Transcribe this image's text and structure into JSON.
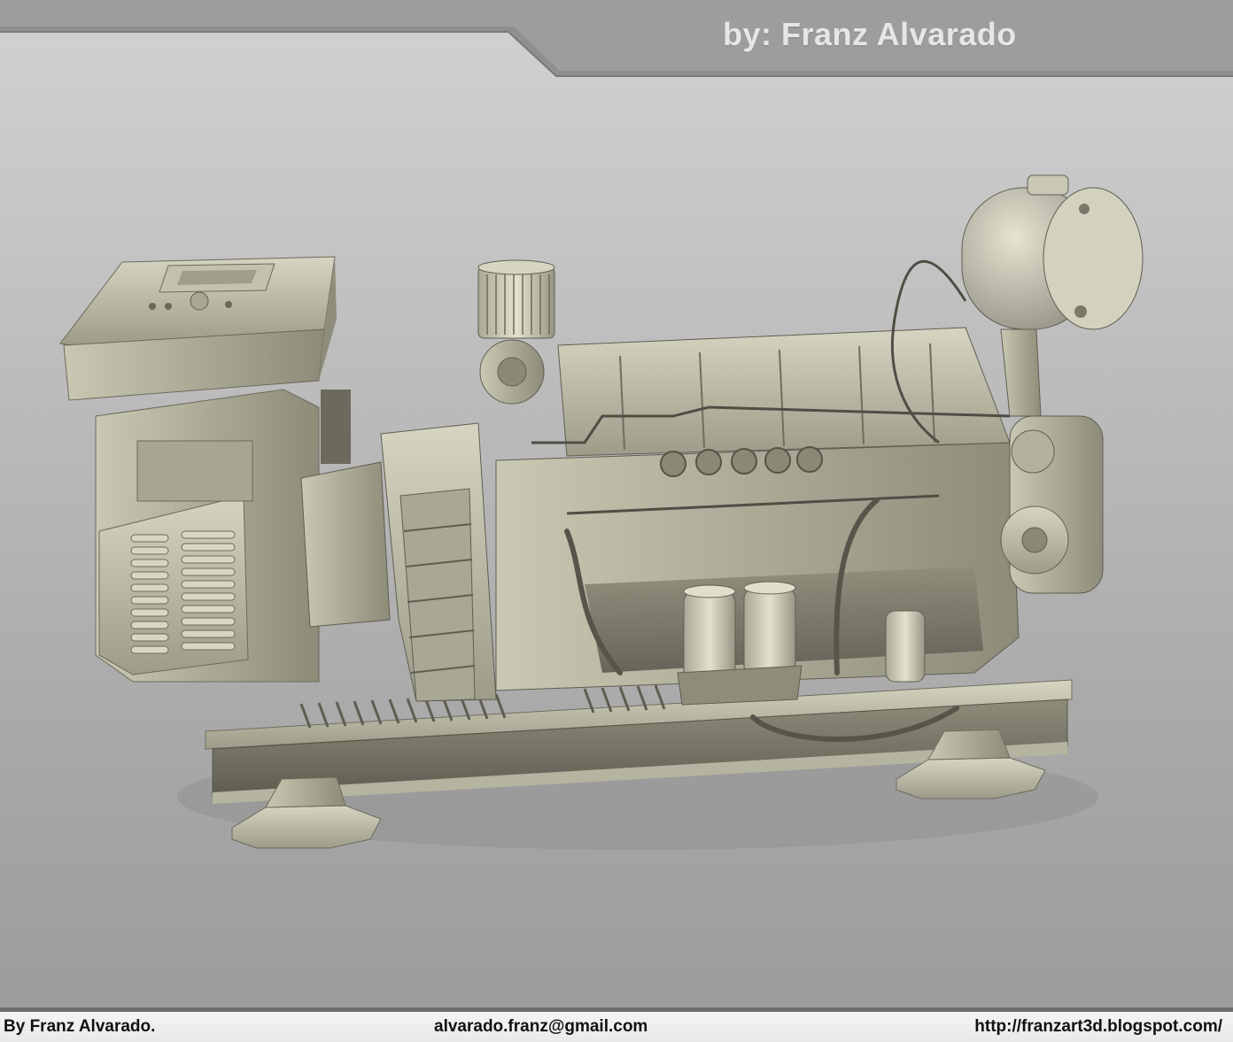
{
  "header": {
    "title": "by: Franz Alvarado"
  },
  "footer": {
    "author": "By Franz Alvarado.",
    "email": "alvarado.franz@gmail.com",
    "website": "http://franzart3d.blogspot.com/"
  },
  "colors": {
    "background_top": "#d2d2d2",
    "background_bottom": "#9a9a9a",
    "header_plate": "#8c8c8c",
    "model_base": "#bdbca6",
    "footer_border": "#6e6e6e"
  }
}
